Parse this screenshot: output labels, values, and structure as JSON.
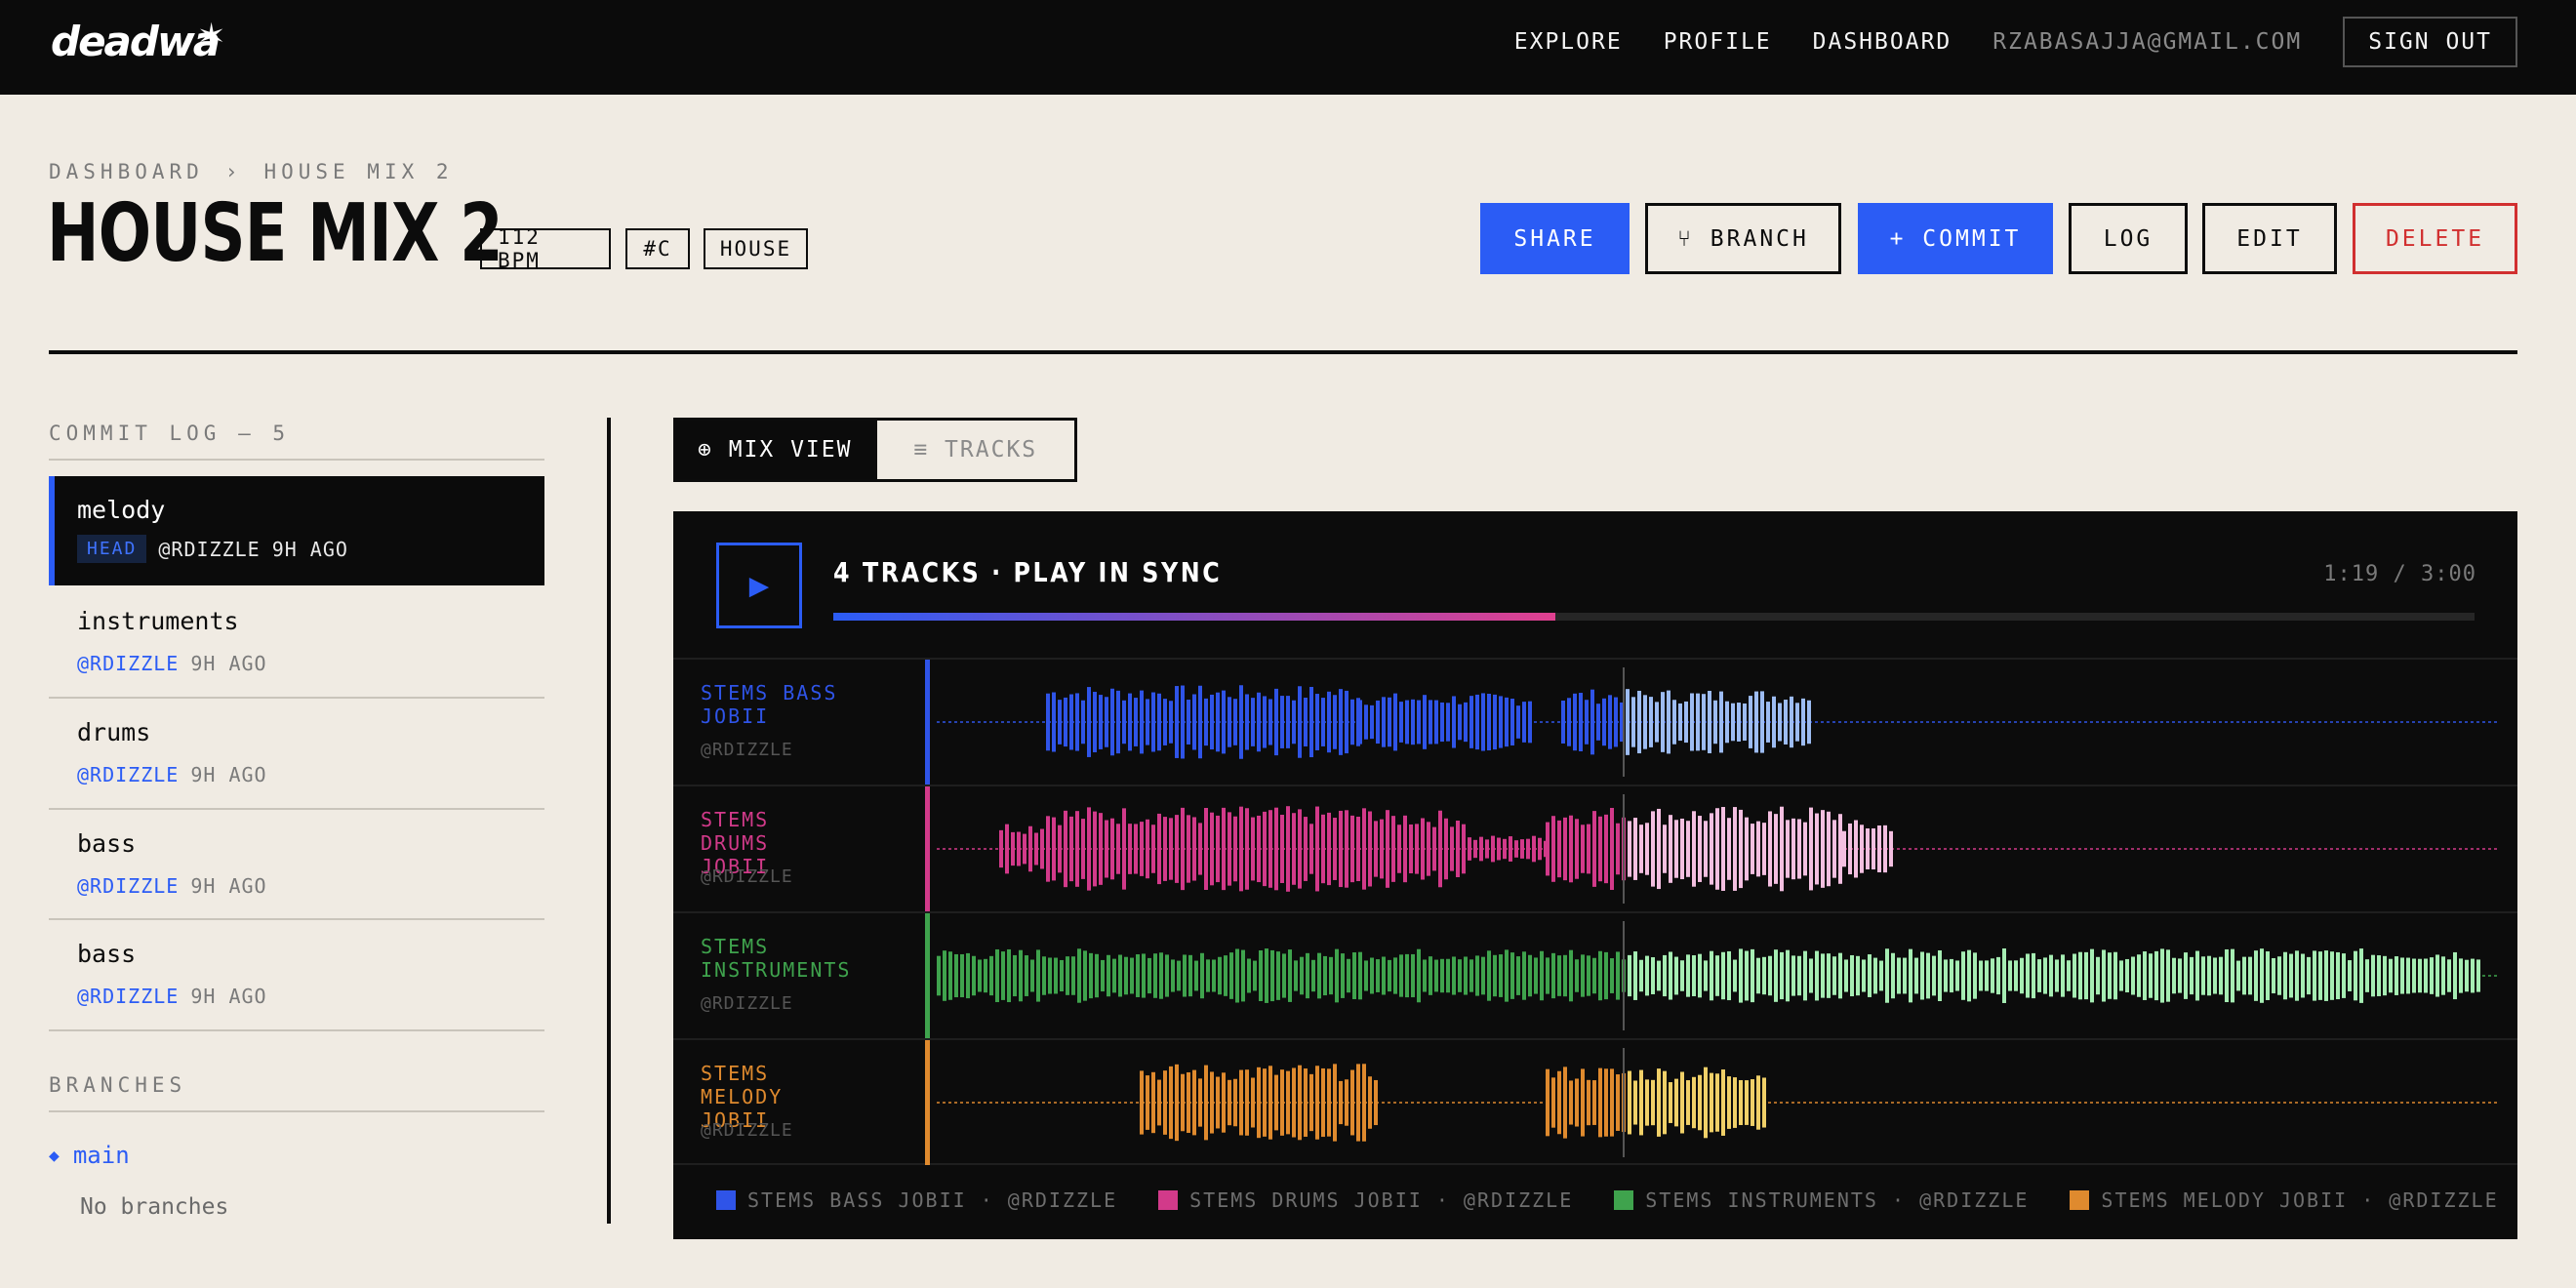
{
  "app": {
    "logo_text": "deadwa",
    "logo_mark": "star-icon"
  },
  "nav": {
    "links": [
      "EXPLORE",
      "PROFILE",
      "DASHBOARD"
    ],
    "email": "RZABASAJJA@GMAIL.COM",
    "signout": "SIGN OUT"
  },
  "breadcrumb": {
    "root": "DASHBOARD",
    "sep": "›",
    "current": "HOUSE MIX 2"
  },
  "project": {
    "title": "HOUSE MIX 2",
    "tags": [
      "112 BPM",
      "#C",
      "HOUSE"
    ]
  },
  "actions": {
    "share": "SHARE",
    "branch": "⑂ BRANCH",
    "commit": "+ COMMIT",
    "log": "LOG",
    "edit": "EDIT",
    "delete": "DELETE"
  },
  "commit_log": {
    "label": "COMMIT LOG — 5",
    "head_badge": "HEAD",
    "items": [
      {
        "name": "melody",
        "author": "@RDIZZLE",
        "time": "9H AGO"
      },
      {
        "name": "instruments",
        "author": "@RDIZZLE",
        "time": "9H AGO"
      },
      {
        "name": "drums",
        "author": "@RDIZZLE",
        "time": "9H AGO"
      },
      {
        "name": "bass",
        "author": "@RDIZZLE",
        "time": "9H AGO"
      },
      {
        "name": "bass",
        "author": "@RDIZZLE",
        "time": "9H AGO"
      }
    ]
  },
  "branches": {
    "label": "BRANCHES",
    "main": "main",
    "empty": "No branches"
  },
  "view_toggle": {
    "mix": "⊕ MIX VIEW",
    "tracks": "≡ TRACKS"
  },
  "player": {
    "title": "4 TRACKS · PLAY IN SYNC",
    "time": "1:19 / 3:00",
    "progress": 0.44,
    "play_icon": "play-icon"
  },
  "colors": {
    "accent": "#2b5cf5",
    "danger": "#d12f2f",
    "bass": "#2f54e8",
    "drums": "#d23a8a",
    "instruments": "#3fa34d",
    "melody": "#df8a2e"
  },
  "tracks": [
    {
      "name1": "STEMS BASS",
      "name2": "JOBII",
      "author": "@RDIZZLE",
      "legend": "STEMS BASS JOBII · @RDIZZLE",
      "color": "#2f54e8",
      "played": "#2f54e8",
      "unplayed": "#9dbcf2"
    },
    {
      "name1": "STEMS DRUMS",
      "name2": "JOBII",
      "author": "@RDIZZLE",
      "legend": "STEMS DRUMS JOBII · @RDIZZLE",
      "color": "#d23a8a",
      "played": "#d23a8a",
      "unplayed": "#f3bfe0"
    },
    {
      "name1": "STEMS",
      "name2": "INSTRUMENTS",
      "author": "@RDIZZLE",
      "legend": "STEMS INSTRUMENTS · @RDIZZLE",
      "color": "#3fa34d",
      "played": "#3fa34d",
      "unplayed": "#a6edb3"
    },
    {
      "name1": "STEMS MELODY",
      "name2": "JOBII",
      "author": "@RDIZZLE",
      "legend": "STEMS MELODY JOBII · @RDIZZLE",
      "color": "#df8a2e",
      "played": "#df8a2e",
      "unplayed": "#f0d068"
    }
  ]
}
